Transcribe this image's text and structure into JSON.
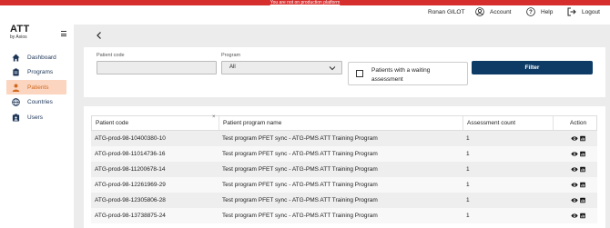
{
  "banner": {
    "text": "You are not on production platform"
  },
  "brand": {
    "name": "ATT",
    "subtitle": "by Axios"
  },
  "sidebar": {
    "items": [
      {
        "label": "Dashboard",
        "icon": "home-icon"
      },
      {
        "label": "Programs",
        "icon": "clipboard-icon"
      },
      {
        "label": "Patients",
        "icon": "person-icon"
      },
      {
        "label": "Countries",
        "icon": "globe-icon"
      },
      {
        "label": "Users",
        "icon": "badge-icon"
      }
    ],
    "active": "Patients"
  },
  "topbar": {
    "user": "Ronan GILOT",
    "account": "Account",
    "help": "Help",
    "logout": "Logout"
  },
  "filters": {
    "patient_code_label": "Patient code",
    "patient_code_value": "",
    "program_label": "Program",
    "program_value": "All",
    "waiting_label": "Patients with a waiting assessment",
    "waiting_checked": false,
    "filter_button": "Filter"
  },
  "table": {
    "headers": [
      "Patient code",
      "Patient program name",
      "Assessment count",
      "Action"
    ],
    "rows": [
      {
        "code": "ATG-prod-98-10400380-10",
        "program": "Test program PFET sync - ATG-PMS ATT Training Program",
        "count": "1"
      },
      {
        "code": "ATG-prod-98-11014736-16",
        "program": "Test program PFET sync - ATG-PMS ATT Training Program",
        "count": "1"
      },
      {
        "code": "ATG-prod-98-11200678-14",
        "program": "Test program PFET sync - ATG-PMS ATT Training Program",
        "count": "1"
      },
      {
        "code": "ATG-prod-98-12261969-29",
        "program": "Test program PFET sync - ATG-PMS ATT Training Program",
        "count": "1"
      },
      {
        "code": "ATG-prod-98-12305806-28",
        "program": "Test program PFET sync - ATG-PMS ATT Training Program",
        "count": "1"
      },
      {
        "code": "ATG-prod-98-13738875-24",
        "program": "Test program PFET sync - ATG-PMS ATT Training Program",
        "count": "1"
      }
    ]
  },
  "colors": {
    "banner": "#d62d2d",
    "primary": "#0d3b66",
    "active_nav_bg": "#fbd5c0",
    "active_nav_text": "#d2691e"
  }
}
